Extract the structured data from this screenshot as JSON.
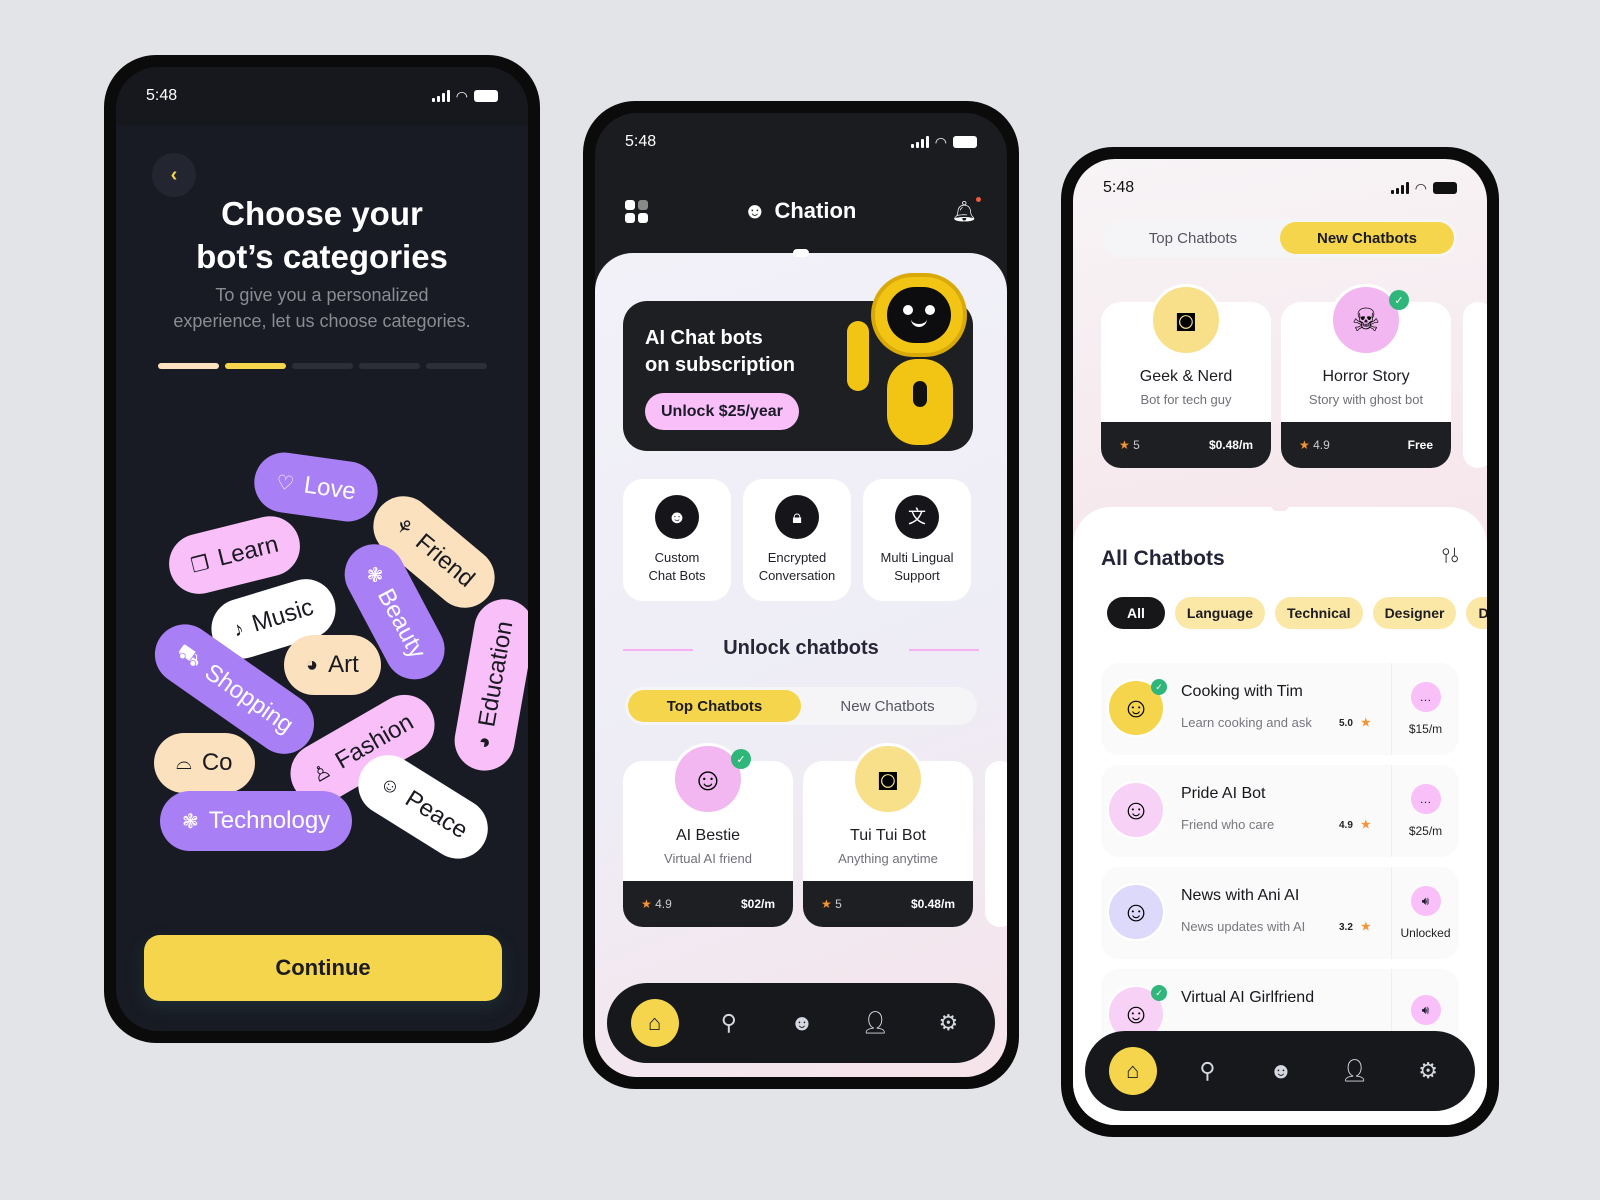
{
  "status_time": "5:48",
  "onboarding": {
    "back_icon": "chevron-left-icon",
    "title_line1": "Choose your",
    "title_line2": "bot’s categories",
    "subtitle_line1": "To give you a personalized",
    "subtitle_line2": "experience, let us choose categories.",
    "progress_total_steps": 5,
    "progress_completed_steps": 2,
    "progress_colors": [
      "#fde2bf",
      "#f5d54b",
      "#2c2f38",
      "#2c2f38",
      "#2c2f38"
    ],
    "categories": [
      {
        "label": "Love",
        "icon": "heart-icon",
        "glyph": "♡",
        "color": "purple"
      },
      {
        "label": "Learn",
        "icon": "book-icon",
        "glyph": "❒",
        "color": "pink"
      },
      {
        "label": "Friend",
        "icon": "handshake-icon",
        "glyph": "⚘",
        "color": "peach"
      },
      {
        "label": "Music",
        "icon": "music-note-icon",
        "glyph": "♪",
        "color": "white"
      },
      {
        "label": "Beauty",
        "icon": "flower-icon",
        "glyph": "❃",
        "color": "purple"
      },
      {
        "label": "Shopping",
        "icon": "cart-icon",
        "glyph": "⛟",
        "color": "purple"
      },
      {
        "label": "Art",
        "icon": "palette-icon",
        "glyph": "◕",
        "color": "peach"
      },
      {
        "label": "Education",
        "icon": "palette-icon",
        "glyph": "◕",
        "color": "pink"
      },
      {
        "label": "Fashion",
        "icon": "dress-icon",
        "glyph": "♙",
        "color": "pink"
      },
      {
        "label": "Co",
        "icon": "cloche-icon",
        "glyph": "⌓",
        "color": "peach"
      },
      {
        "label": "Peace",
        "icon": "smile-icon",
        "glyph": "☺",
        "color": "white"
      },
      {
        "label": "Technology",
        "icon": "cog-icon",
        "glyph": "❃",
        "color": "purple"
      }
    ],
    "continue_label": "Continue"
  },
  "home": {
    "app_name": "Chation",
    "promo": {
      "title_line1": "AI Chat bots",
      "title_line2": "on subscription",
      "button_label": "Unlock $25/year"
    },
    "features": [
      {
        "line1": "Custom",
        "line2": "Chat Bots",
        "icon": "bot-icon",
        "glyph": "☻"
      },
      {
        "line1": "Encrypted",
        "line2": "Conversation",
        "icon": "lock-key-icon",
        "glyph": "🔒︎"
      },
      {
        "line1": "Multi Lingual",
        "line2": "Support",
        "icon": "translate-icon",
        "glyph": "文"
      }
    ],
    "section_title": "Unlock chatbots",
    "tabs": [
      {
        "label": "Top Chatbots",
        "active": true
      },
      {
        "label": "New Chatbots",
        "active": false
      }
    ],
    "bots": [
      {
        "name": "AI Bestie",
        "desc": "Virtual AI friend",
        "rating": "4.9",
        "price": "$02/m",
        "verified": true,
        "avatar_bg": "#f2b7f0",
        "glyph": "☺"
      },
      {
        "name": "Tui Tui Bot",
        "desc": "Anything anytime",
        "rating": "5",
        "price": "$0.48/m",
        "verified": false,
        "avatar_bg": "#f8e08a",
        "glyph": "◙"
      }
    ]
  },
  "explore": {
    "tabs": [
      {
        "label": "Top Chatbots",
        "active": false
      },
      {
        "label": "New Chatbots",
        "active": true
      }
    ],
    "bots": [
      {
        "name": "Geek & Nerd",
        "desc": "Bot for tech guy",
        "rating": "5",
        "price": "$0.48/m",
        "verified": false,
        "avatar_bg": "#f8e08a",
        "glyph": "◙"
      },
      {
        "name": "Horror Story",
        "desc": "Story with ghost bot",
        "rating": "4.9",
        "price": "Free",
        "verified": true,
        "avatar_bg": "#f2b7f0",
        "glyph": "☠"
      }
    ],
    "list_title": "All Chatbots",
    "filters": [
      "All",
      "Language",
      "Technical",
      "Designer",
      "Do"
    ],
    "active_filter": "All",
    "chatbots": [
      {
        "name": "Cooking with Tim",
        "desc": "Learn cooking and ask",
        "rating": "5.0",
        "action_icon": "chat-bubble-icon",
        "glyph": "…",
        "price": "$15/m",
        "verified": true,
        "avatar_bg": "#f5d54b"
      },
      {
        "name": "Pride AI Bot",
        "desc": "Friend who care",
        "rating": "4.9",
        "action_icon": "chat-bubble-icon",
        "glyph": "…",
        "price": "$25/m",
        "verified": false,
        "avatar_bg": "#f8d2f6"
      },
      {
        "name": "News with Ani AI",
        "desc": "News updates with AI",
        "rating": "3.2",
        "action_icon": "speaker-icon",
        "glyph": "🔊︎",
        "price": "Unlocked",
        "verified": false,
        "avatar_bg": "#dcd9fb"
      },
      {
        "name": "Virtual AI Girlfriend",
        "desc": "",
        "rating": "",
        "action_icon": "speaker-icon",
        "glyph": "🔊︎",
        "price": "",
        "verified": true,
        "avatar_bg": "#f8d2f6"
      }
    ]
  },
  "nav": [
    {
      "name": "home",
      "icon": "home-icon",
      "glyph": "⌂",
      "active": true
    },
    {
      "name": "search",
      "icon": "search-icon",
      "glyph": "⚲",
      "active": false
    },
    {
      "name": "bots",
      "icon": "bot-icon",
      "glyph": "☻",
      "active": false
    },
    {
      "name": "profile",
      "icon": "user-icon",
      "glyph": "👤︎",
      "active": false
    },
    {
      "name": "settings",
      "icon": "gear-icon",
      "glyph": "⚙",
      "active": false
    }
  ]
}
